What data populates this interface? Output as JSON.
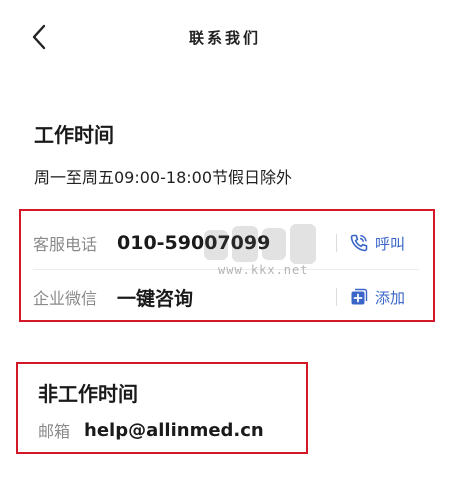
{
  "header": {
    "title": "联系我们",
    "back_icon": "chevron-left-icon"
  },
  "work_hours": {
    "title": "工作时间",
    "description": "周一至周五09:00-18:00节假日除外"
  },
  "contacts": [
    {
      "label": "客服电话",
      "value": "010-59007099",
      "action_label": "呼叫",
      "action_icon": "phone-icon"
    },
    {
      "label": "企业微信",
      "value": "一键咨询",
      "action_label": "添加",
      "action_icon": "add-square-icon"
    }
  ],
  "off_hours": {
    "title": "非工作时间",
    "email_label": "邮箱",
    "email_value": "help@allinmed.cn"
  },
  "watermark": {
    "text": "www.kkx.net"
  },
  "colors": {
    "highlight_border": "#d4182a",
    "action_blue": "#3a66c9",
    "label_gray": "#8a8a8a",
    "text_dark": "#1a1a1a"
  }
}
